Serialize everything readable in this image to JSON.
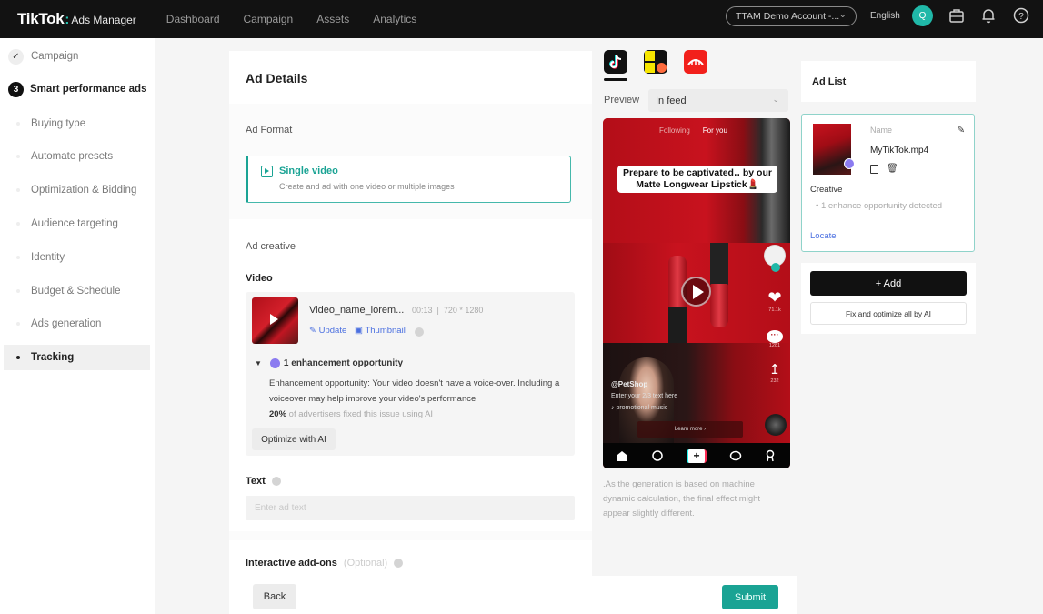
{
  "topbar": {
    "logo_main": "TikTok",
    "logo_sub": "Ads Manager",
    "nav": [
      "Dashboard",
      "Campaign",
      "Assets",
      "Analytics"
    ],
    "account": "TTAM Demo Account -...",
    "language": "English",
    "avatar_initial": "Q",
    "icons": [
      "briefcase-icon",
      "bell-icon",
      "help-icon"
    ]
  },
  "sidebar": {
    "items": [
      {
        "label": "Campaign",
        "state": "done"
      },
      {
        "label": "Smart performance ads",
        "state": "current",
        "number": "3"
      },
      {
        "label": "Buying type",
        "state": "sub"
      },
      {
        "label": "Automate presets",
        "state": "sub"
      },
      {
        "label": "Optimization & Bidding",
        "state": "sub"
      },
      {
        "label": "Audience targeting",
        "state": "sub"
      },
      {
        "label": "Identity",
        "state": "sub"
      },
      {
        "label": "Budget & Schedule",
        "state": "sub"
      },
      {
        "label": "Ads generation",
        "state": "sub"
      },
      {
        "label": "Tracking",
        "state": "active"
      }
    ]
  },
  "main": {
    "title": "Ad Details",
    "ad_format": {
      "label": "Ad Format",
      "option_title": "Single video",
      "option_desc": "Create and ad with one video or multiple images"
    },
    "ad_creative_label": "Ad creative",
    "video": {
      "label": "Video",
      "name": "Video_name_lorem...",
      "duration": "00:13",
      "resolution": "720 * 1280",
      "update_label": "Update",
      "thumbnail_label": "Thumbnail",
      "enhancement_title": "1 enhancement opportunity",
      "enhancement_text": "Enhancement opportunity: Your video doesn't have a voice-over. Including a voiceover may help improve your video's performance",
      "stat_value": "20%",
      "stat_text": "of advertisers fixed this issue using AI",
      "optimize_label": "Optimize with AI"
    },
    "text": {
      "label": "Text",
      "placeholder": "Enter ad text"
    },
    "interactive": {
      "label": "Interactive add-ons",
      "optional": "(Optional)"
    }
  },
  "footer": {
    "back_label": "Back",
    "submit_label": "Submit"
  },
  "preview": {
    "platforms": [
      "TikTok",
      "Pangle",
      "CapCut"
    ],
    "label": "Preview",
    "placement": "In feed",
    "phone": {
      "tab_following": "Following",
      "tab_for_you": "For you",
      "caption": "Prepare to be captivated‥ by our Matte Longwear Lipstick💄",
      "likes": "71.1k",
      "comments": "1281",
      "shares": "232",
      "handle": "@PetShop",
      "ad_text": "Enter your 2/3 text here",
      "music": "♪ promotional music",
      "cta": "Learn more ›"
    },
    "note": ".As the generation is based on machine dynamic calculation, the final effect might appear slightly different."
  },
  "ad_list": {
    "title": "Ad List",
    "card": {
      "name_label": "Name",
      "name": "MyTikTok.mp4",
      "creative_label": "Creative",
      "issue": "1 enhance opportunity detected",
      "locate_label": "Locate"
    },
    "add_label": "+ Add",
    "fix_label": "Fix and optimize all by AI"
  }
}
